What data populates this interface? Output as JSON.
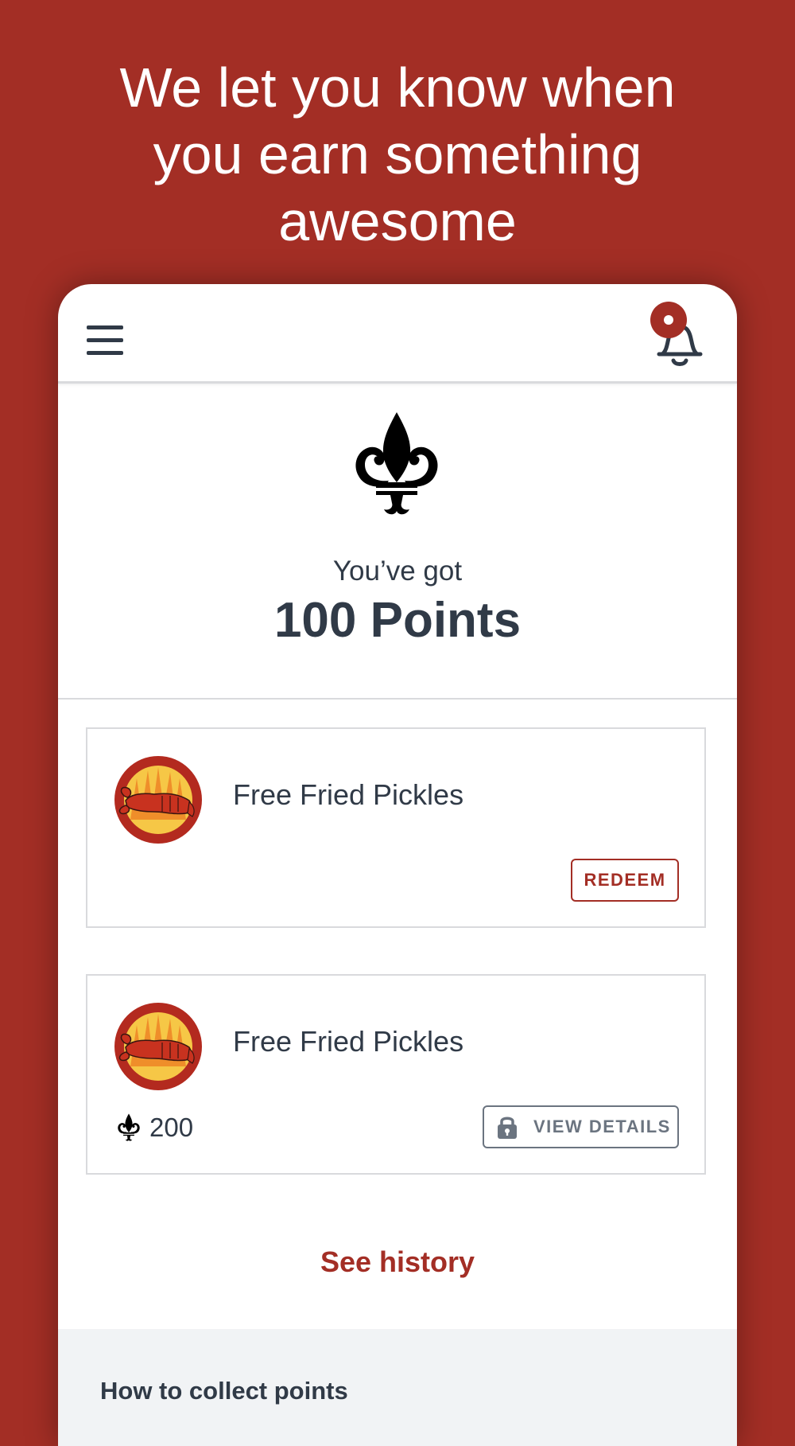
{
  "headline": "We let you know when\nyou earn something\nawesome",
  "app": {
    "topbar": {
      "menu_icon": "hamburger-menu-icon",
      "notification_icon": "bell-icon",
      "has_unread_notification": true
    },
    "points": {
      "logo_icon": "fleur-de-lis-icon",
      "intro": "You’ve got",
      "total": "100 Points"
    },
    "rewards": [
      {
        "title": "Free Fried Pickles",
        "image_icon": "crawfish-reward-image",
        "action_label": "REDEEM",
        "locked": false
      },
      {
        "title": "Free Fried Pickles",
        "image_icon": "crawfish-reward-image",
        "cost": "200",
        "cost_icon": "fleur-de-lis-icon",
        "action_label": "VIEW DETAILS",
        "action_icon": "lock-icon",
        "locked": true
      }
    ],
    "history_link": "See history",
    "collect": {
      "title": "How to collect points"
    }
  },
  "colors": {
    "brand_red": "#a32e25",
    "text_dark": "#303a47",
    "muted_gray": "#6b7480",
    "divider": "#d9dadd",
    "section_bg": "#f1f3f5"
  }
}
